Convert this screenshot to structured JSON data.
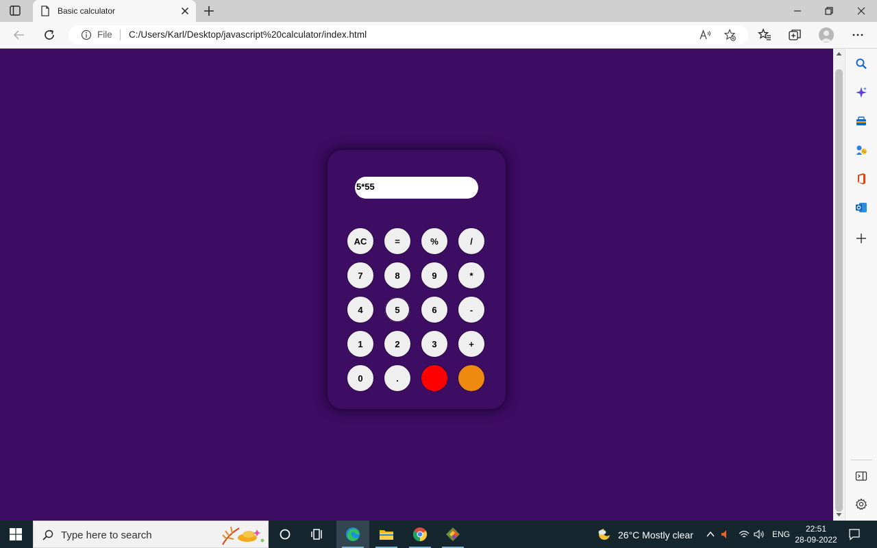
{
  "browser": {
    "tab_title": "Basic calculator",
    "address_scheme": "File",
    "address_url": "C:/Users/Karl/Desktop/javascript%20calculator/index.html"
  },
  "calculator": {
    "display_value": "5*55",
    "colors": {
      "background": "#3d0c63",
      "key": "#efefef",
      "key_red": "#ff0000",
      "key_orange": "#ee8a10"
    },
    "rows": [
      [
        "AC",
        "=",
        "%",
        "/"
      ],
      [
        "7",
        "8",
        "9",
        "*"
      ],
      [
        "4",
        "5",
        "6",
        "-"
      ],
      [
        "1",
        "2",
        "3",
        "+"
      ],
      [
        "0",
        ".",
        "",
        ""
      ]
    ]
  },
  "taskbar": {
    "search_placeholder": "Type here to search",
    "weather": "26°C  Mostly clear",
    "language": "ENG",
    "time": "22:51",
    "date": "28-09-2022"
  }
}
